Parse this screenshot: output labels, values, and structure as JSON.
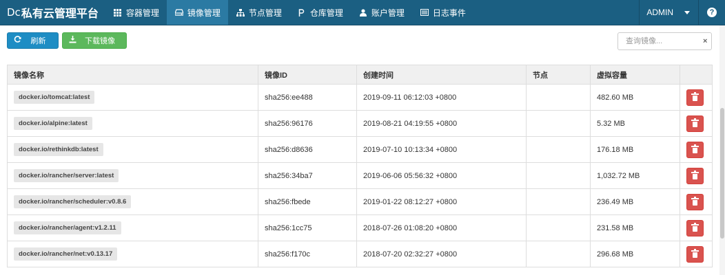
{
  "navbar": {
    "brand_logo": "Dc",
    "brand_title": "私有云管理平台",
    "items": [
      {
        "label": "容器管理",
        "icon": "grid-icon"
      },
      {
        "label": "镜像管理",
        "icon": "drive-icon",
        "active": true
      },
      {
        "label": "节点管理",
        "icon": "sitemap-icon"
      },
      {
        "label": "仓库管理",
        "icon": "parking-icon"
      },
      {
        "label": "账户管理",
        "icon": "user-icon"
      },
      {
        "label": "日志事件",
        "icon": "list-icon"
      }
    ],
    "user": "ADMIN",
    "help": "?"
  },
  "toolbar": {
    "refresh_label": "刷新",
    "download_label": "下载镜像",
    "search_placeholder": "查询镜像...",
    "clear": "×"
  },
  "table": {
    "headers": [
      "镜像名称",
      "镜像ID",
      "创建时间",
      "节点",
      "虚拟容量",
      ""
    ],
    "rows": [
      {
        "name": "docker.io/tomcat:latest",
        "id": "sha256:ee488",
        "created": "2019-09-11 06:12:03 +0800",
        "node": "",
        "size": "482.60 MB"
      },
      {
        "name": "docker.io/alpine:latest",
        "id": "sha256:96176",
        "created": "2019-08-21 04:19:55 +0800",
        "node": "",
        "size": "5.32 MB"
      },
      {
        "name": "docker.io/rethinkdb:latest",
        "id": "sha256:d8636",
        "created": "2019-07-10 10:13:34 +0800",
        "node": "",
        "size": "176.18 MB"
      },
      {
        "name": "docker.io/rancher/server:latest",
        "id": "sha256:34ba7",
        "created": "2019-06-06 05:56:32 +0800",
        "node": "",
        "size": "1,032.72 MB"
      },
      {
        "name": "docker.io/rancher/scheduler:v0.8.6",
        "id": "sha256:fbede",
        "created": "2019-01-22 08:12:27 +0800",
        "node": "",
        "size": "236.49 MB"
      },
      {
        "name": "docker.io/rancher/agent:v1.2.11",
        "id": "sha256:1cc75",
        "created": "2018-07-26 01:08:20 +0800",
        "node": "",
        "size": "231.58 MB"
      },
      {
        "name": "docker.io/rancher/net:v0.13.17",
        "id": "sha256:f170c",
        "created": "2018-07-20 02:32:27 +0800",
        "node": "",
        "size": "296.68 MB"
      }
    ]
  },
  "colors": {
    "navbar": "#1b5f82",
    "nav_active": "#2b7aa3",
    "refresh": "#1e8dc4",
    "download": "#5cb85c",
    "delete": "#d9534f"
  }
}
